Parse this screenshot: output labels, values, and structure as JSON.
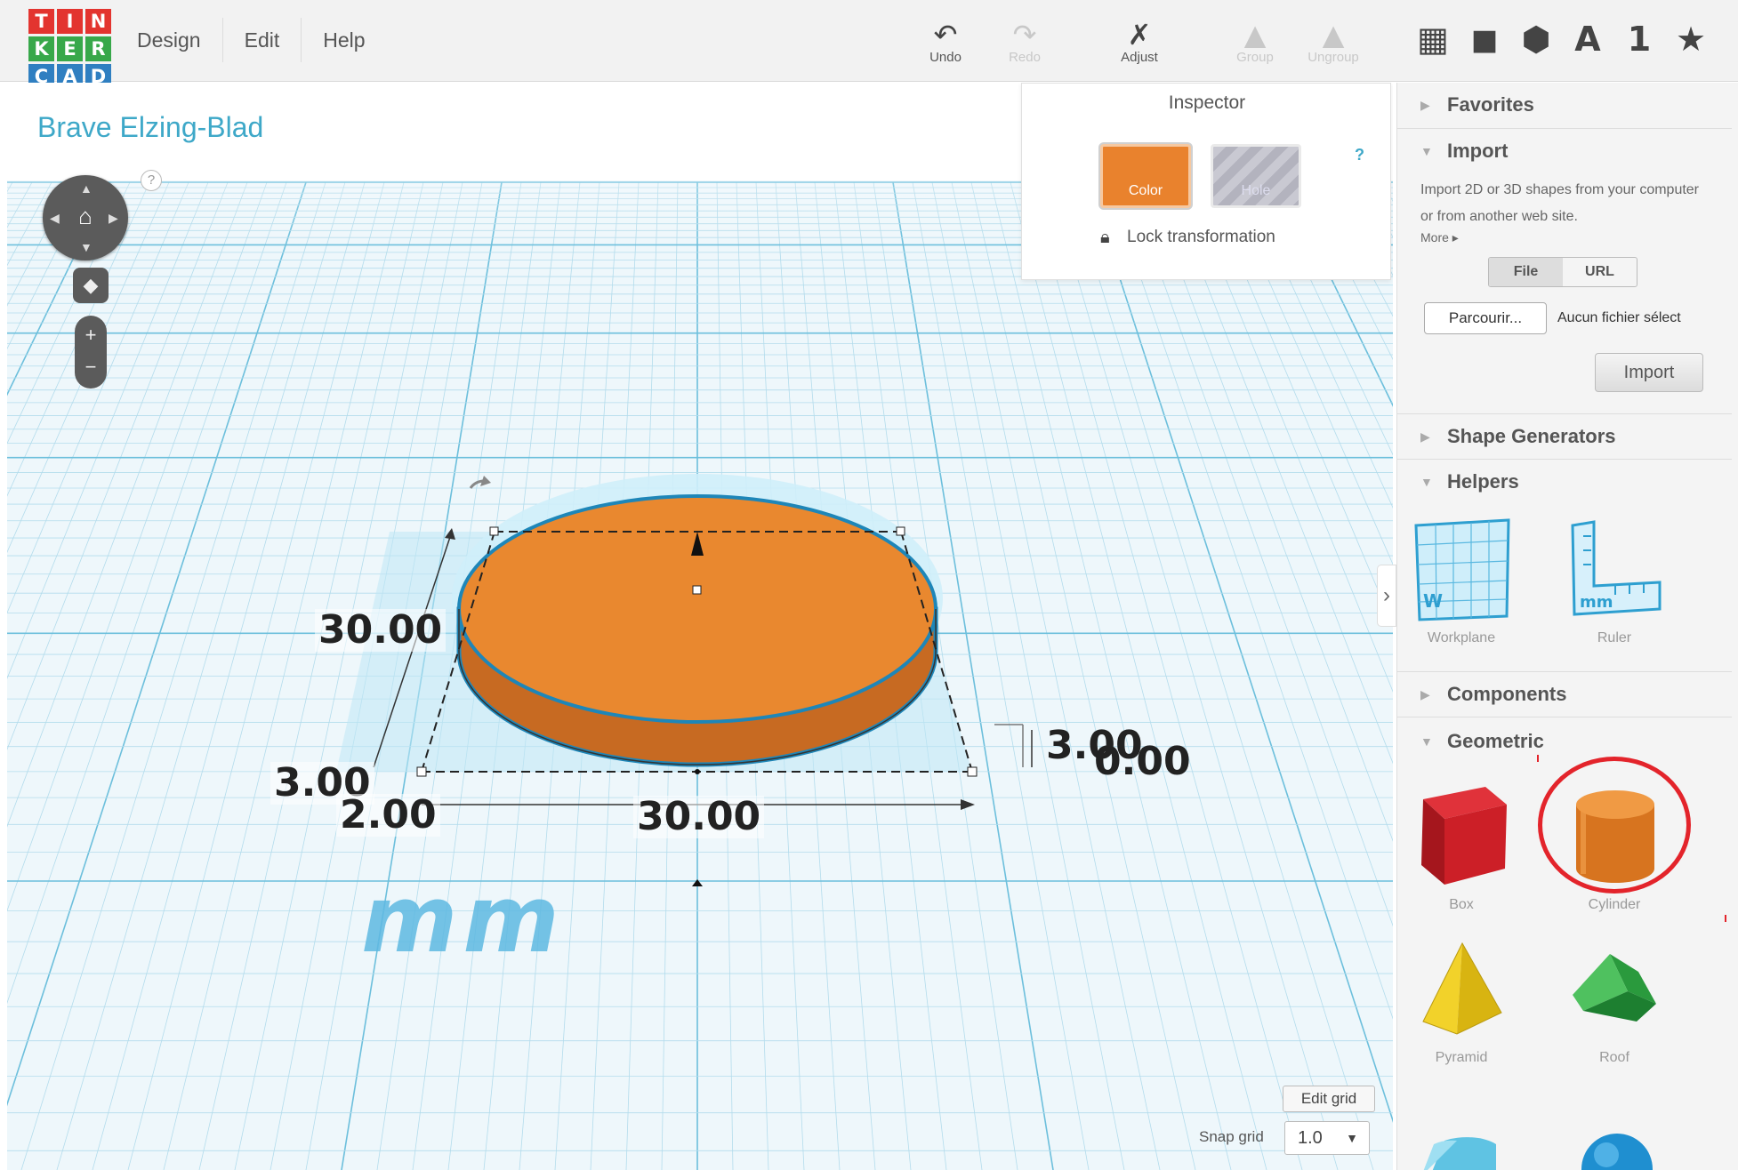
{
  "logo": {
    "letters": [
      "T",
      "I",
      "N",
      "K",
      "E",
      "R",
      "C",
      "A",
      "D"
    ],
    "colors": [
      "#e3342f",
      "#e3342f",
      "#e3342f",
      "#38a84a",
      "#38a84a",
      "#38a84a",
      "#2f7fc1",
      "#2f7fc1",
      "#2f7fc1"
    ]
  },
  "menu": {
    "design": "Design",
    "edit": "Edit",
    "help": "Help"
  },
  "toolbar": {
    "undo": "Undo",
    "redo": "Redo",
    "adjust": "Adjust",
    "group": "Group",
    "ungroup": "Ungroup"
  },
  "views": {
    "letter_a": "A",
    "number_1": "1"
  },
  "design_title": "Brave Elzing-Blad",
  "help_mark": "?",
  "inspector": {
    "title": "Inspector",
    "color_label": "Color",
    "hole_label": "Hole",
    "help": "?",
    "lock_label": "Lock transformation"
  },
  "dimensions": {
    "length": "30.00",
    "width": "30.00",
    "height": "3.00",
    "elevation": "0.00",
    "left_offset": "3.00",
    "front_offset": "2.00"
  },
  "units_label": "mm",
  "snap": {
    "edit_grid": "Edit grid",
    "label": "Snap grid",
    "value": "1.0"
  },
  "panel": {
    "favorites": "Favorites",
    "import": "Import",
    "import_desc": "Import 2D or 3D shapes from your computer or from another web site.",
    "more": "More ▸",
    "file_tab": "File",
    "url_tab": "URL",
    "browse": "Parcourir...",
    "no_file": "Aucun fichier sélect",
    "import_button": "Import",
    "shape_generators": "Shape Generators",
    "helpers": "Helpers",
    "workplane": "Workplane",
    "ruler": "Ruler",
    "components": "Components",
    "geometric": "Geometric",
    "box": "Box",
    "cylinder": "Cylinder",
    "pyramid": "Pyramid",
    "roof": "Roof"
  },
  "colors": {
    "accent": "#3ea8c8",
    "shape_orange": "#e9822d",
    "highlight_red": "#e3242b"
  }
}
